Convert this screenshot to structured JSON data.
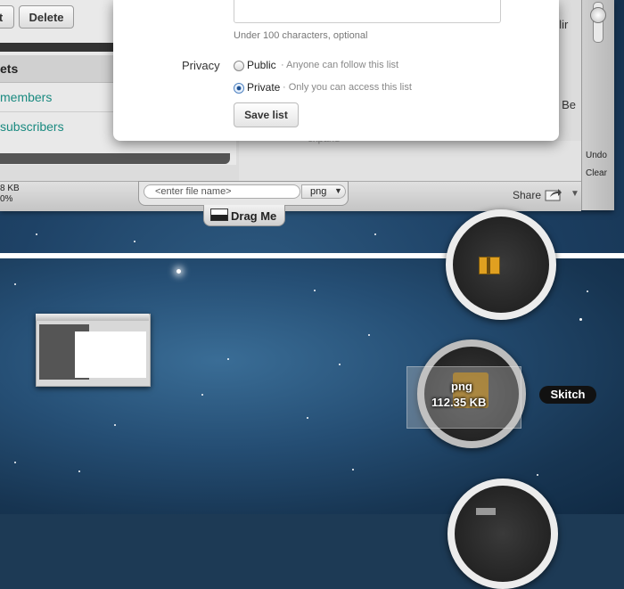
{
  "toolbar": {
    "edit_label": "t",
    "delete_label": "Delete"
  },
  "sidebar": {
    "header": "ets",
    "members": "members",
    "subscribers": "subscribers"
  },
  "background_text": {
    "right_top": "nlir",
    "right_mid": "s Be",
    "under_modal": "expand"
  },
  "dialog": {
    "description_hint": "Under 100 characters, optional",
    "privacy_label": "Privacy",
    "public_label": "Public",
    "public_desc": "· Anyone can follow this list",
    "private_label": "Private",
    "private_desc": "· Only you can access this list",
    "selected_privacy": "Private",
    "save_button": "Save list"
  },
  "status": {
    "file_size_line1": "8 KB",
    "file_size_line2": "0%",
    "share_label": "Share"
  },
  "side_tools": {
    "undo": "Undo",
    "clear": "Clear"
  },
  "filename_bar": {
    "placeholder": "<enter file name>",
    "format": "png",
    "drag_label": "Drag Me"
  },
  "drop_target": {
    "format": "png",
    "size": "112.35 KB",
    "app_tag": "Skitch"
  },
  "colors": {
    "link_teal": "#1a8a80",
    "radio_selected": "#1d4f91",
    "desktop_blue": "#1e4266"
  }
}
